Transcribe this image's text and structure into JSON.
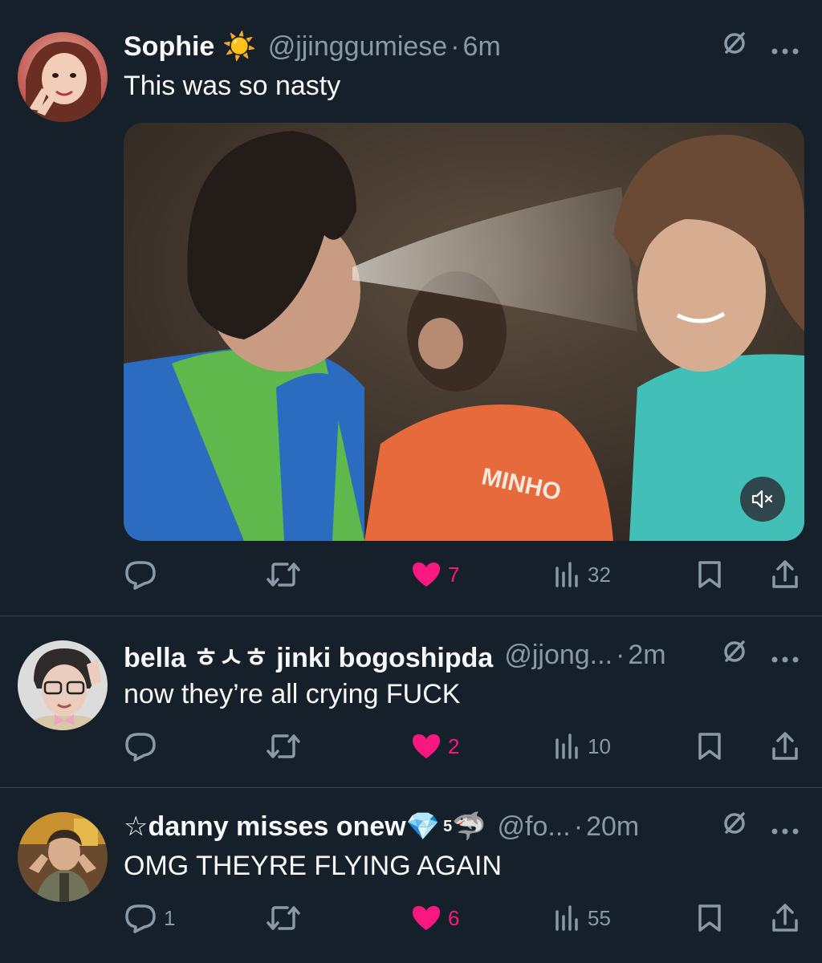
{
  "colors": {
    "background": "#15202b",
    "text": "#f7f9f9",
    "muted": "#8b98a5",
    "like": "#f91880",
    "divider": "#38444d"
  },
  "tweets": [
    {
      "name": "Sophie",
      "name_emoji": "☀️",
      "handle": "@jjinggumiese",
      "separator": "·",
      "time": "6m",
      "text": "This was so nasty",
      "has_media": true,
      "media_overlay_text": "MINHO",
      "counts": {
        "reply": "",
        "retweet": "",
        "like": "7",
        "views": "32"
      },
      "liked": true
    },
    {
      "name": "bella ㅎㅅㅎ jinki bogoshipda",
      "handle": "@jjong...",
      "separator": "·",
      "time": "2m",
      "text": "now they’re all crying FUCK",
      "has_media": false,
      "counts": {
        "reply": "",
        "retweet": "",
        "like": "2",
        "views": "10"
      },
      "liked": true
    },
    {
      "name": "☆danny misses onew",
      "name_emoji": "💎",
      "name_sup": "5",
      "name_emoji2": "🦈",
      "handle": "@fo...",
      "separator": "·",
      "time": "20m",
      "text": "OMG THEYRE FLYING AGAIN",
      "has_media": false,
      "counts": {
        "reply": "1",
        "retweet": "",
        "like": "6",
        "views": "55"
      },
      "liked": true
    }
  ]
}
